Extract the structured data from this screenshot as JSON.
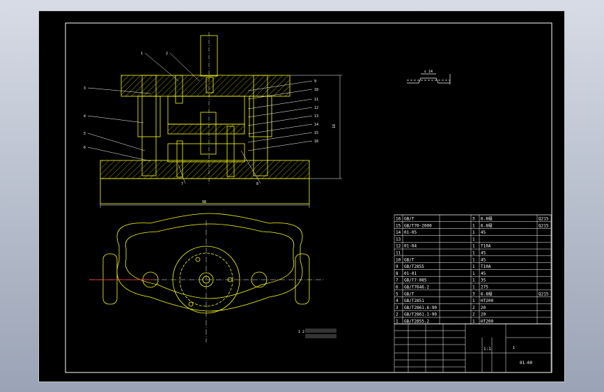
{
  "drawing": {
    "colors": {
      "background": "#000000",
      "line": "#ffff00",
      "frame": "#ffffff",
      "center": "#ff3b3b",
      "text": "#ffffff"
    },
    "dim_width": "98",
    "dim_height": "18",
    "detail_label": "ε 14"
  },
  "callouts_left": [
    "1",
    "2",
    "3",
    "4",
    "5",
    "6",
    "7",
    "8"
  ],
  "callouts_right": [
    "9",
    "10",
    "11",
    "12",
    "13",
    "14",
    "15",
    "16"
  ],
  "bom": {
    "rows": [
      [
        "16",
        "GB/T",
        "",
        "3",
        "6.8级",
        "Q215"
      ],
      [
        "15",
        "GB/T70-2000",
        "",
        "1",
        "6.8级",
        "Q215"
      ],
      [
        "14",
        "01-05",
        "",
        "1",
        "45",
        ""
      ],
      [
        "13",
        "",
        "",
        "1",
        "",
        ""
      ],
      [
        "12",
        "01-04",
        "",
        "1",
        "T10A",
        ""
      ],
      [
        "11",
        "",
        "",
        "1",
        "45",
        ""
      ],
      [
        "10",
        "GB/T",
        "",
        "1",
        "45",
        ""
      ],
      [
        "9",
        "GB/T2855",
        "",
        "1",
        "T10A",
        ""
      ],
      [
        "8",
        "01-01",
        "",
        "1",
        "45",
        ""
      ],
      [
        "7",
        "GB/T7-085",
        "",
        "1",
        "35",
        ""
      ],
      [
        "6",
        "GB/T7646.2",
        "",
        "1",
        "275",
        ""
      ],
      [
        "5",
        "GB/T",
        "",
        "3",
        "6.8级",
        "Q215"
      ],
      [
        "4",
        "GB/T2851",
        "",
        "1",
        "HT200",
        ""
      ],
      [
        "3",
        "GB/T2861.6-90",
        "",
        "2",
        "20",
        ""
      ],
      [
        "2",
        "GB/T2861.1-90",
        "",
        "2",
        "20",
        ""
      ],
      [
        "1",
        "GB/T2855.2",
        "",
        "1",
        "HT200",
        ""
      ]
    ]
  },
  "title_block": {
    "scale": "1:1",
    "drawing_no": "01-00",
    "company_left_label": "1",
    "tech_note": "1 2"
  }
}
